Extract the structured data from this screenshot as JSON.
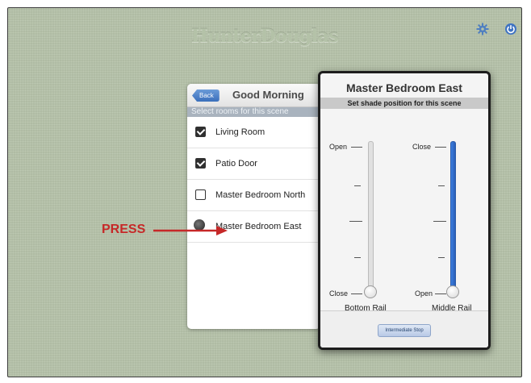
{
  "brand": {
    "logo_text": "HunterDouglas"
  },
  "header": {
    "settings_icon": "gear-icon",
    "power_icon": "power-icon"
  },
  "scene": {
    "back_label": "Back",
    "title": "Good Morning",
    "subheading": "Select rooms for this scene",
    "rooms": [
      {
        "label": "Living Room",
        "checked": true
      },
      {
        "label": "Patio Door",
        "checked": true
      },
      {
        "label": "Master Bedroom North",
        "checked": false
      },
      {
        "label": "Master Bedroom East",
        "checked": false
      }
    ]
  },
  "annotation": {
    "label": "PRESS",
    "color": "#c62828"
  },
  "modal": {
    "title": "Master Bedroom East",
    "subtitle": "Set shade position for this scene",
    "bottom_rail": {
      "label": "Bottom Rail",
      "top_label": "Open",
      "bottom_label": "Close",
      "position": 0
    },
    "middle_rail": {
      "label": "Middle Rail",
      "top_label": "Close",
      "bottom_label": "Open",
      "position": 0
    },
    "button_label": "Intermediate Stop"
  },
  "colors": {
    "background": "#b6c3aa",
    "accent_blue": "#3c7ee0"
  }
}
